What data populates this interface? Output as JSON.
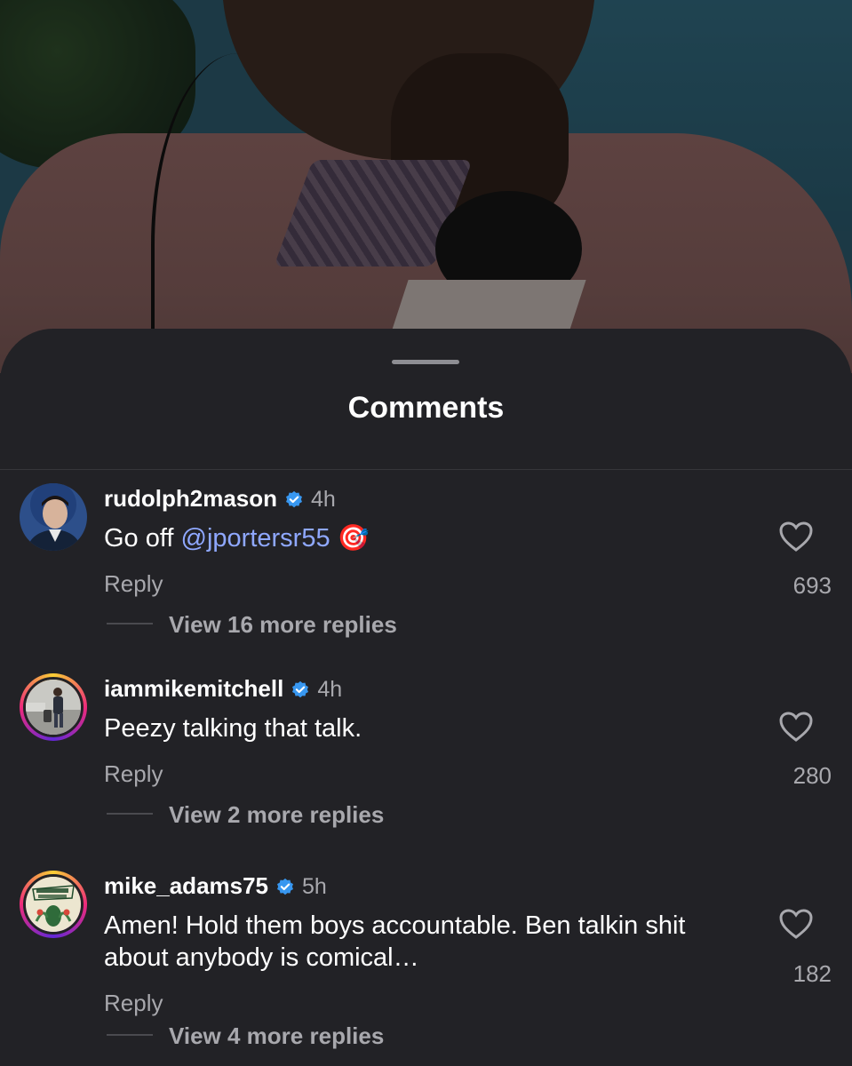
{
  "sheet": {
    "title": "Comments"
  },
  "comments": [
    {
      "username": "rudolph2mason",
      "verified_icon": "verified-badge-icon",
      "time": "4h",
      "text_prefix": "Go off ",
      "mention": "@jportersr55",
      "emoji": "🎯",
      "reply_label": "Reply",
      "likes": "693",
      "view_replies": "View 16 more replies"
    },
    {
      "username": "iammikemitchell",
      "verified_icon": "verified-badge-icon",
      "time": "4h",
      "text": "Peezy talking that talk.",
      "reply_label": "Reply",
      "likes": "280",
      "view_replies": "View 2 more replies"
    },
    {
      "username": "mike_adams75",
      "verified_icon": "verified-badge-icon",
      "time": "5h",
      "text": "Amen! Hold them boys accountable. Ben talkin shit about anybody is comical…",
      "reply_label": "Reply",
      "likes": "182",
      "view_replies": "View 4 more replies"
    }
  ],
  "colors": {
    "background": "#222226",
    "text": "#ffffff",
    "secondary": "#a8a8ad",
    "mention": "#8fa8ff",
    "verified": "#3897f0"
  }
}
